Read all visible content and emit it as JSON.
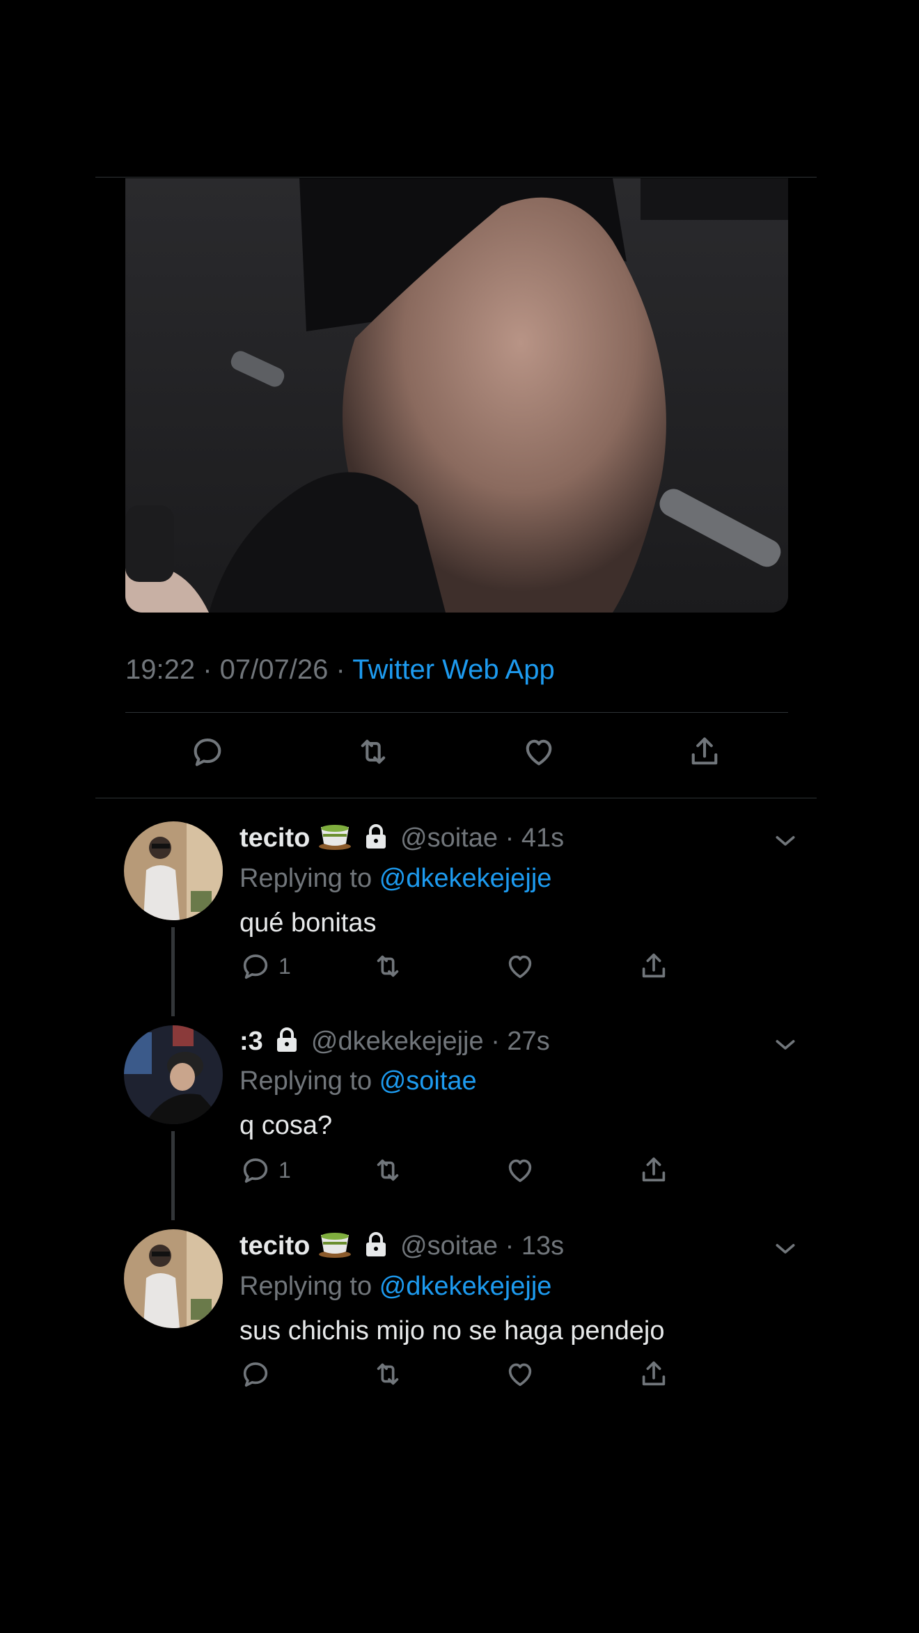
{
  "tweet": {
    "time": "19:22",
    "date": "07/07/26",
    "source": "Twitter Web App"
  },
  "replies": [
    {
      "name": "tecito",
      "handle": "@soitae",
      "age": "41s",
      "replying_label": "Replying to",
      "replying_to": "@dkekekejejje",
      "text": "qué bonitas",
      "reply_count": "1"
    },
    {
      "name": ":3",
      "handle": "@dkekekejejje",
      "age": "27s",
      "replying_label": "Replying to",
      "replying_to": "@soitae",
      "text": "q cosa?",
      "reply_count": "1"
    },
    {
      "name": "tecito",
      "handle": "@soitae",
      "age": "13s",
      "replying_label": "Replying to",
      "replying_to": "@dkekekejejje",
      "text": "sus chichis mijo no se haga pendejo",
      "reply_count": ""
    }
  ],
  "colors": {
    "accent": "#1d9bf0",
    "muted": "#71767b",
    "background": "#000000",
    "text": "#e7e9ea"
  },
  "icons": [
    "reply-icon",
    "retweet-icon",
    "like-icon",
    "share-icon",
    "chevron-down-icon",
    "lock-icon",
    "tea-emoji"
  ]
}
